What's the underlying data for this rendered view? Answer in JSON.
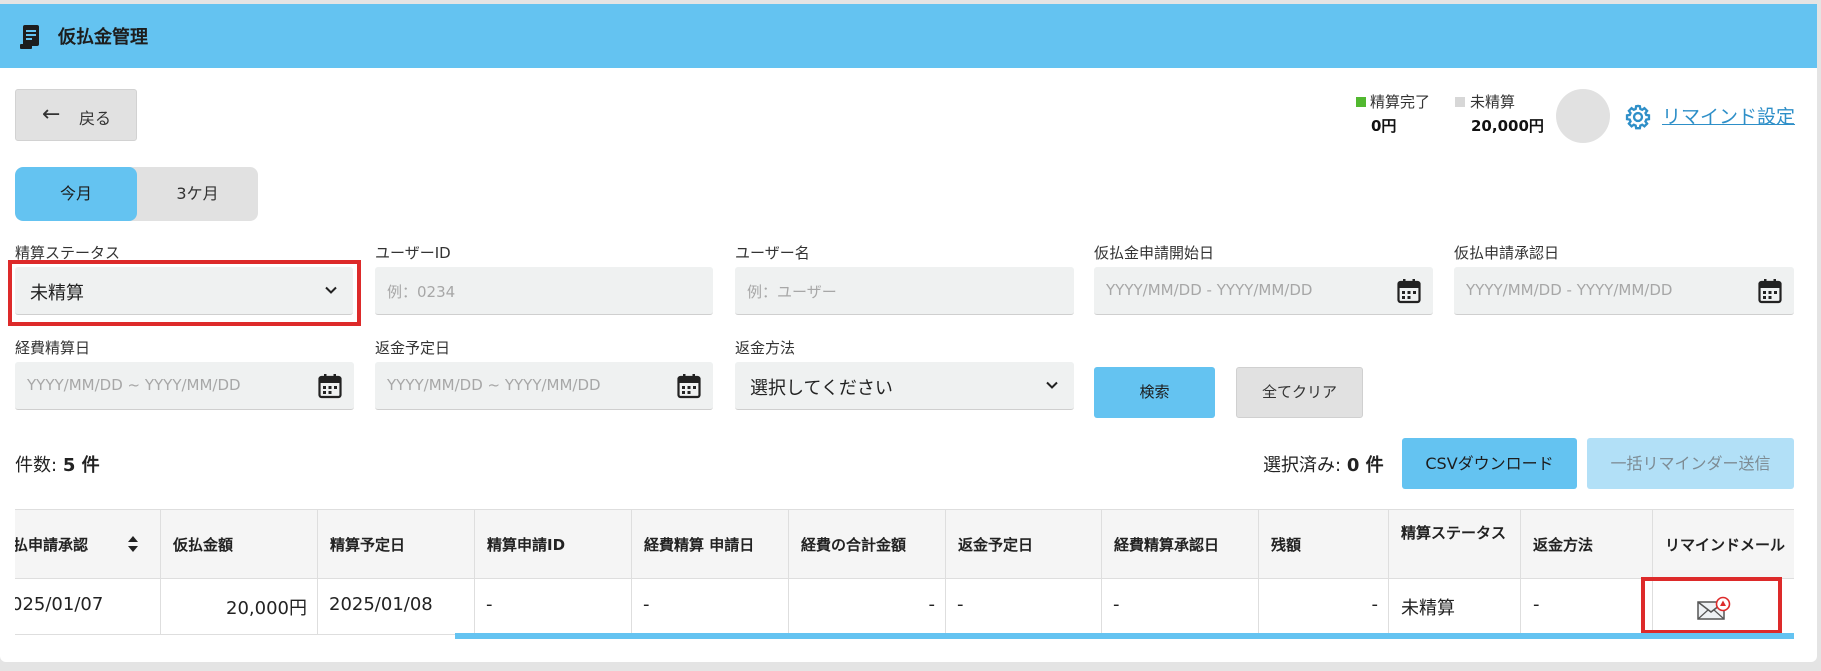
{
  "header": {
    "title": "仮払金管理",
    "icon": "receipt-icon"
  },
  "back_button": {
    "label": "戻る",
    "icon": "arrow-left-icon"
  },
  "summary": {
    "settled": {
      "label": "精算完了",
      "value": "0円",
      "color": "#52b830"
    },
    "unsettled": {
      "label": "未精算",
      "value": "20,000円",
      "color": "#d7d7d7"
    }
  },
  "remind_settings": {
    "label": "リマインド設定",
    "icon": "gear-icon"
  },
  "period_tabs": [
    {
      "label": "今月",
      "active": true
    },
    {
      "label": "3ケ月",
      "active": false
    }
  ],
  "filters": {
    "status": {
      "label": "精算ステータス",
      "value": "未精算"
    },
    "user_id": {
      "label": "ユーザーID",
      "placeholder": "例：0234"
    },
    "user_name": {
      "label": "ユーザー名",
      "placeholder": "例：ユーザー"
    },
    "advance_start_date": {
      "label": "仮払金申請開始日",
      "placeholder": "YYYY/MM/DD - YYYY/MM/DD"
    },
    "advance_approve_date": {
      "label": "仮払申請承認日",
      "placeholder": "YYYY/MM/DD - YYYY/MM/DD"
    },
    "expense_settle_date": {
      "label": "経費精算日",
      "placeholder": "YYYY/MM/DD ~ YYYY/MM/DD"
    },
    "refund_due_date": {
      "label": "返金予定日",
      "placeholder": "YYYY/MM/DD ~ YYYY/MM/DD"
    },
    "refund_method": {
      "label": "返金方法",
      "value": "選択してください"
    }
  },
  "actions": {
    "search": "検索",
    "clear": "全てクリア"
  },
  "results": {
    "count_label": "件数:",
    "count_value": "5 件",
    "selected_label": "選択済み:",
    "selected_value": "0 件",
    "csv_button": "CSVダウンロード",
    "bulk_remind_button": "一括リマインダー送信"
  },
  "table": {
    "headers": [
      "払申請承認",
      "仮払金額",
      "精算予定日",
      "精算申請ID",
      "経費精算 申請日",
      "経費の合計金額",
      "返金予定日",
      "経費精算承認日",
      "残額",
      "精算ステータス",
      "返金方法",
      "リマインドメール"
    ],
    "rows": [
      {
        "approve_date": "025/01/07",
        "amount": "20,000円",
        "settle_due": "2025/01/08",
        "settle_id": "-",
        "expense_apply_date": "-",
        "expense_total": "-",
        "refund_due": "-",
        "expense_approve_date": "-",
        "balance": "-",
        "status": "未精算",
        "refund_method": "-",
        "remind_icon": "mail-alert-icon"
      }
    ]
  }
}
